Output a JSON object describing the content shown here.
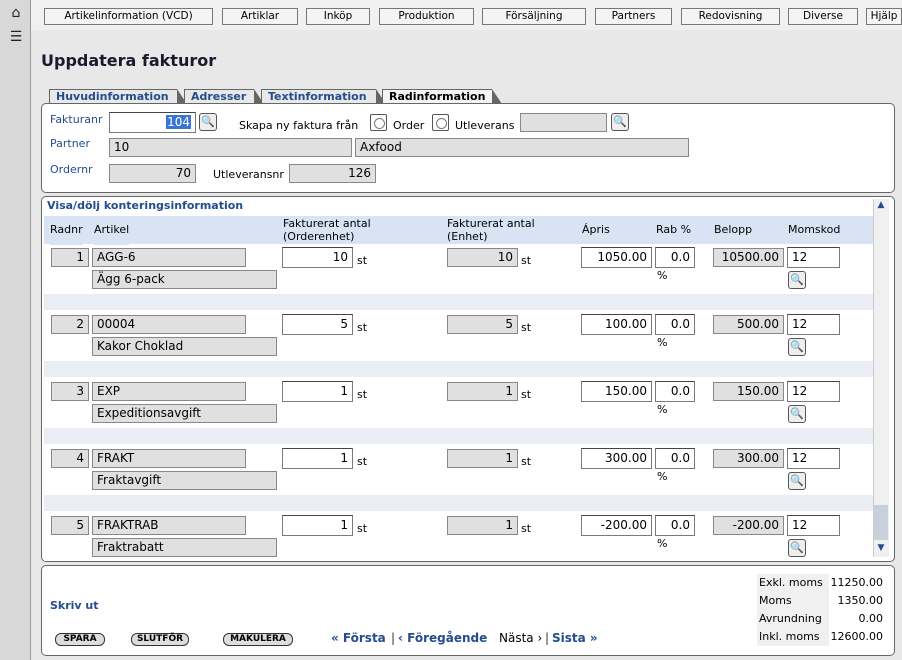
{
  "sidebar": {
    "home_icon": "home-icon",
    "menu_icon": "list-icon"
  },
  "topnav": [
    "Artikelinformation (VCD)",
    "Artiklar",
    "Inköp",
    "Produktion",
    "Försäljning",
    "Partners",
    "Redovisning",
    "Diverse",
    "Hjälp"
  ],
  "page_title": "Uppdatera fakturor",
  "tabs": [
    "Huvudinformation",
    "Adresser",
    "Textinformation",
    "Radinformation"
  ],
  "header": {
    "fakturanr_label": "Fakturanr",
    "fakturanr": "104",
    "skapa_label": "Skapa ny faktura från",
    "order_label": "Order",
    "utleverans_label": "Utleverans",
    "utleverans_value": "",
    "partner_label": "Partner",
    "partner_id": "10",
    "partner_name": "Axfood",
    "ordernr_label": "Ordernr",
    "ordernr": "70",
    "utleveransnr_label": "Utleveransnr",
    "utleveransnr": "126"
  },
  "grid": {
    "toggle_label": "Visa/dölj konteringsinformation",
    "columns": [
      "Radnr",
      "Artikel",
      "Fakturerat antal\n(Orderenhet)",
      "Fakturerat antal\n(Enhet)",
      "Ápris",
      "Rab %",
      "Belopp",
      "Momskod"
    ],
    "unit": "st",
    "pct": "%",
    "rows": [
      {
        "radnr": "1",
        "code": "AGG-6",
        "name": "Ägg 6-pack",
        "antal_order": "10",
        "antal_enhet": "10",
        "apris": "1050.00",
        "rab": "0.0",
        "belopp": "10500.00",
        "moms": "12"
      },
      {
        "radnr": "2",
        "code": "00004",
        "name": "Kakor Choklad",
        "antal_order": "5",
        "antal_enhet": "5",
        "apris": "100.00",
        "rab": "0.0",
        "belopp": "500.00",
        "moms": "12"
      },
      {
        "radnr": "3",
        "code": "EXP",
        "name": "Expeditionsavgift",
        "antal_order": "1",
        "antal_enhet": "1",
        "apris": "150.00",
        "rab": "0.0",
        "belopp": "150.00",
        "moms": "12"
      },
      {
        "radnr": "4",
        "code": "FRAKT",
        "name": "Fraktavgift",
        "antal_order": "1",
        "antal_enhet": "1",
        "apris": "300.00",
        "rab": "0.0",
        "belopp": "300.00",
        "moms": "12"
      },
      {
        "radnr": "5",
        "code": "FRAKTRAB",
        "name": "Fraktrabatt",
        "antal_order": "1",
        "antal_enhet": "1",
        "apris": "-200.00",
        "rab": "0.0",
        "belopp": "-200.00",
        "moms": "12"
      }
    ]
  },
  "footer": {
    "print_label": "Skriv ut",
    "buttons": [
      "SPARA",
      "SLUTFÖR",
      "MAKULERA"
    ],
    "pager": {
      "first": "« Första",
      "prev": "‹ Föregående",
      "next": "Nästa ›",
      "last": "Sista »"
    },
    "totals": [
      {
        "label": "Exkl. moms",
        "value": "11250.00"
      },
      {
        "label": "Moms",
        "value": "1350.00"
      },
      {
        "label": "Avrundning",
        "value": "0.00"
      },
      {
        "label": "Inkl. moms",
        "value": "12600.00"
      }
    ]
  }
}
